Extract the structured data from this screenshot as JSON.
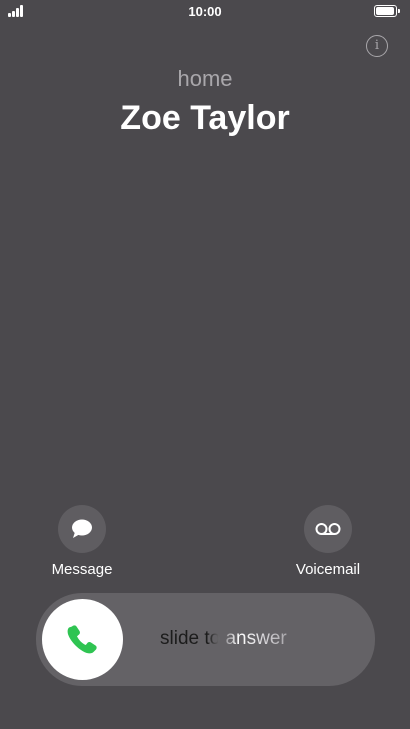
{
  "status_bar": {
    "time": "10:00",
    "signal_icon": "signal-bars-icon",
    "battery_icon": "battery-full-icon"
  },
  "info": {
    "icon": "info-icon",
    "glyph": "i"
  },
  "caller": {
    "label": "home",
    "name": "Zoe Taylor"
  },
  "actions": {
    "message": {
      "label": "Message",
      "icon": "message-bubble-icon"
    },
    "voicemail": {
      "label": "Voicemail",
      "icon": "voicemail-icon"
    }
  },
  "slider": {
    "text": "slide to answer",
    "icon": "phone-icon",
    "accent": "#2fc452"
  },
  "colors": {
    "background": "#4b494d",
    "secondary_text": "#a9a7ab",
    "button_fill": "#5f5d61"
  }
}
